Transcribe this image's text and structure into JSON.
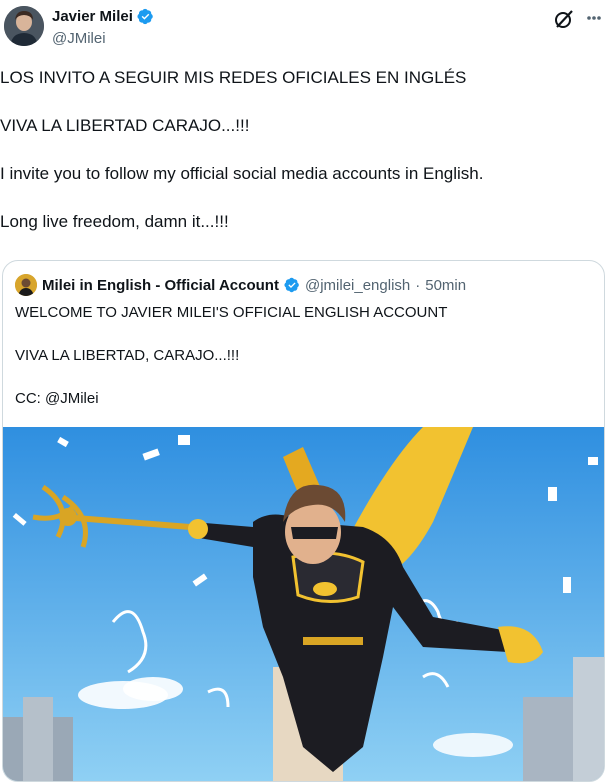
{
  "author": {
    "display_name": "Javier Milei",
    "handle": "@JMilei"
  },
  "tweet": {
    "paragraphs": [
      "LOS INVITO A SEGUIR MIS REDES OFICIALES EN INGLÉS",
      "VIVA LA LIBERTAD CARAJO...!!!",
      "I invite you to follow my official social media accounts in English.",
      "Long live freedom, damn it...!!!"
    ]
  },
  "quoted": {
    "display_name": "Milei in English - Official Account",
    "handle": "@jmilei_english",
    "separator": "·",
    "time": "50min",
    "paragraphs": [
      "WELCOME TO JAVIER MILEI'S OFFICIAL ENGLISH ACCOUNT",
      "VIVA LA LIBERTAD, CARAJO...!!!",
      "CC: @JMilei"
    ]
  },
  "icons": {
    "verified": "verified-badge-icon",
    "grok": "grok-icon",
    "more": "more-icon"
  },
  "colors": {
    "verified_blue": "#1d9bf0",
    "text_primary": "#0f1419",
    "text_secondary": "#536471",
    "border": "#cfd9de",
    "sky": "#3aa6e8",
    "cape_yellow": "#f2c230"
  }
}
